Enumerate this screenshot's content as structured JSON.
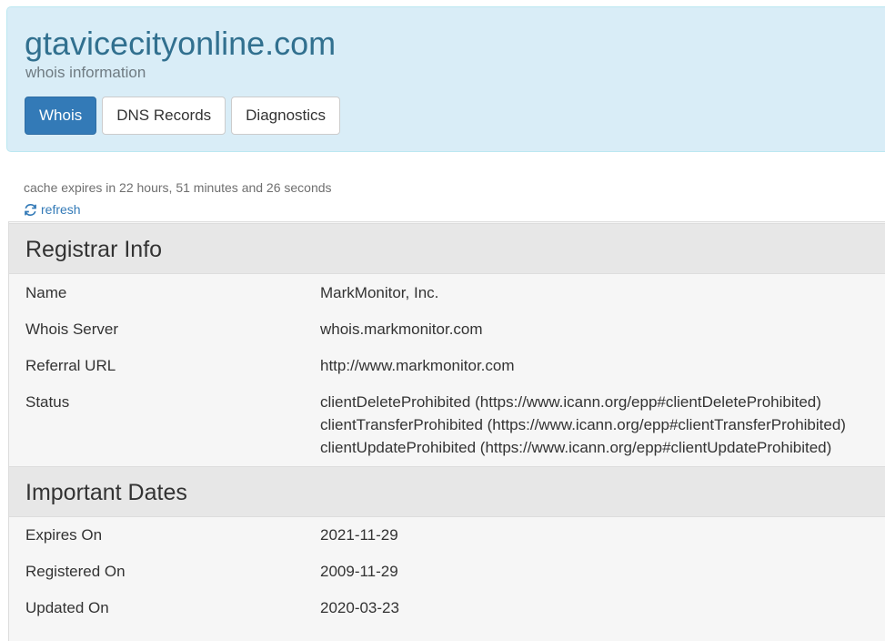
{
  "header": {
    "title": "gtavicecityonline.com",
    "subtitle": "whois information",
    "tabs": [
      {
        "label": "Whois",
        "active": true
      },
      {
        "label": "DNS Records",
        "active": false
      },
      {
        "label": "Diagnostics",
        "active": false
      }
    ],
    "background_color": "#d9edf7",
    "title_color": "#31708f",
    "active_tab_color": "#337ab7"
  },
  "cache": {
    "text": "cache expires in 22 hours, 51 minutes and 26 seconds",
    "refresh_label": "refresh",
    "refresh_icon": "refresh-icon"
  },
  "registrar": {
    "heading": "Registrar Info",
    "name_label": "Name",
    "name_value": "MarkMonitor, Inc.",
    "whois_server_label": "Whois Server",
    "whois_server_value": "whois.markmonitor.com",
    "referral_url_label": "Referral URL",
    "referral_url_value": "http://www.markmonitor.com",
    "status_label": "Status",
    "status_values": [
      "clientDeleteProhibited (https://www.icann.org/epp#clientDeleteProhibited)",
      "clientTransferProhibited (https://www.icann.org/epp#clientTransferProhibited)",
      "clientUpdateProhibited (https://www.icann.org/epp#clientUpdateProhibited)"
    ]
  },
  "dates": {
    "heading": "Important Dates",
    "expires_label": "Expires On",
    "expires_value": "2021-11-29",
    "registered_label": "Registered On",
    "registered_value": "2009-11-29",
    "updated_label": "Updated On",
    "updated_value": "2020-03-23"
  }
}
